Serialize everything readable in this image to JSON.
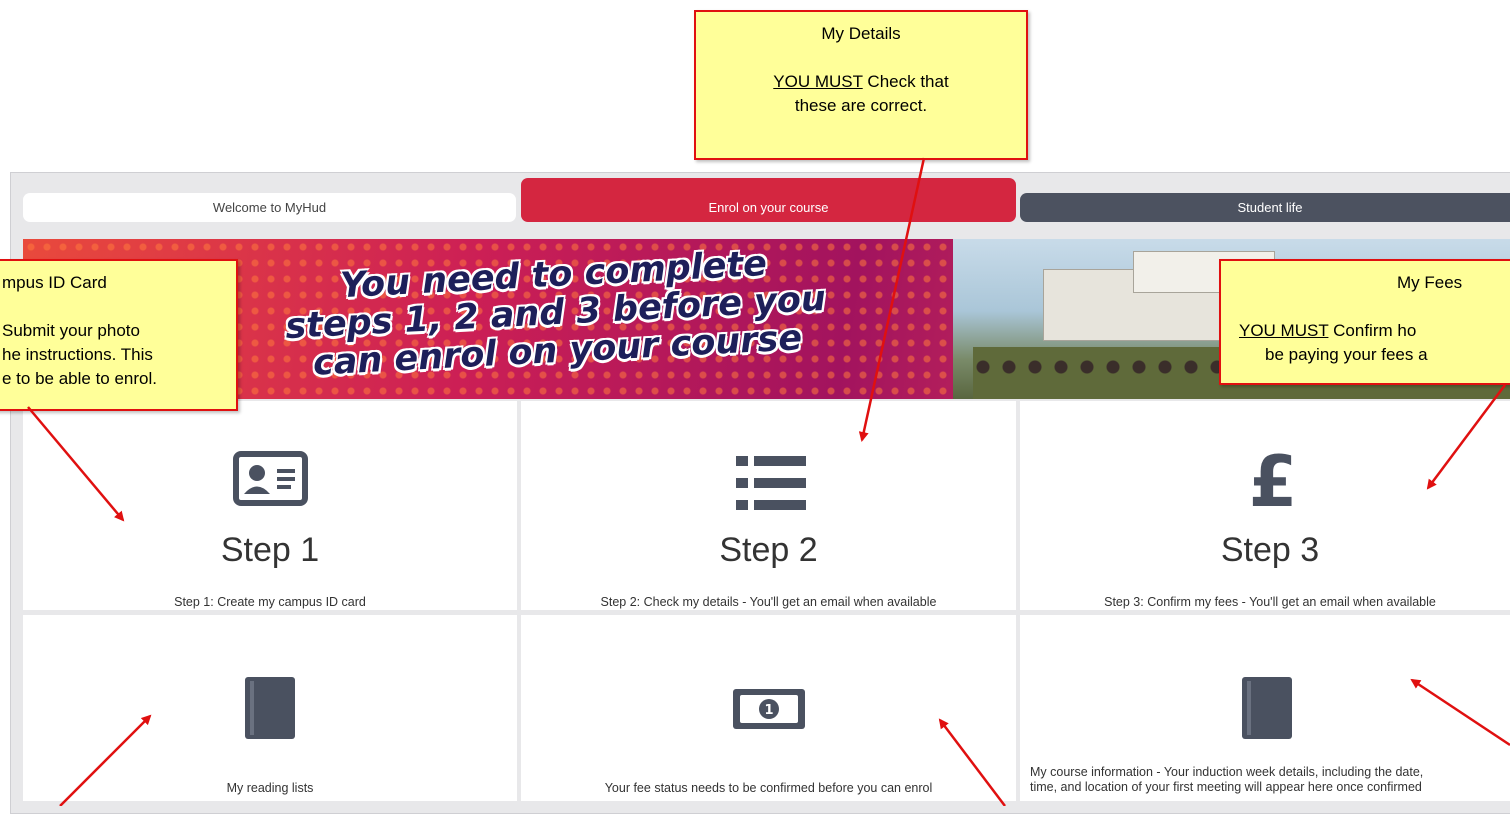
{
  "tabs": [
    {
      "label": "Welcome to MyHud"
    },
    {
      "label": "Enrol on your course"
    },
    {
      "label": "Student life"
    }
  ],
  "banner": {
    "lines": [
      "You need to complete",
      "steps 1, 2 and 3 before you",
      "can enrol on your course"
    ]
  },
  "tiles": [
    {
      "step": "Step 1",
      "desc": "Step 1: Create my campus ID card",
      "icon": "id-card-icon"
    },
    {
      "step": "Step 2",
      "desc": "Step 2: Check my details - You'll get an email when available",
      "icon": "list-icon"
    },
    {
      "step": "Step 3",
      "desc": "Step 3: Confirm my fees - You'll get an email when available",
      "icon": "pound-icon"
    },
    {
      "desc": "My reading lists",
      "icon": "book-icon"
    },
    {
      "desc": "Your fee status needs to be confirmed before you can enrol",
      "icon": "money-icon"
    },
    {
      "desc_line1": "My course information - Your induction week details, including the date,",
      "desc_line2": "time, and location of your first meeting will appear here once confirmed",
      "icon": "book-icon"
    }
  ],
  "callouts": {
    "details": {
      "title": "My Details",
      "must": "YOU MUST",
      "text1": " Check that",
      "text2": "these are correct."
    },
    "fees": {
      "title": "My Fees",
      "must": "YOU MUST",
      "text1": " Confirm ho",
      "text2": "be paying your fees a"
    },
    "id_card": {
      "title": "mpus ID Card",
      "line1": "Submit your photo",
      "line2": "he instructions. This",
      "line3": "e to be able to enrol."
    }
  },
  "colors": {
    "active_tab": "#d42640",
    "dark_tab": "#4c5260",
    "callout_bg": "#ffff99",
    "callout_border": "#e01010",
    "icon": "#4a5160"
  }
}
